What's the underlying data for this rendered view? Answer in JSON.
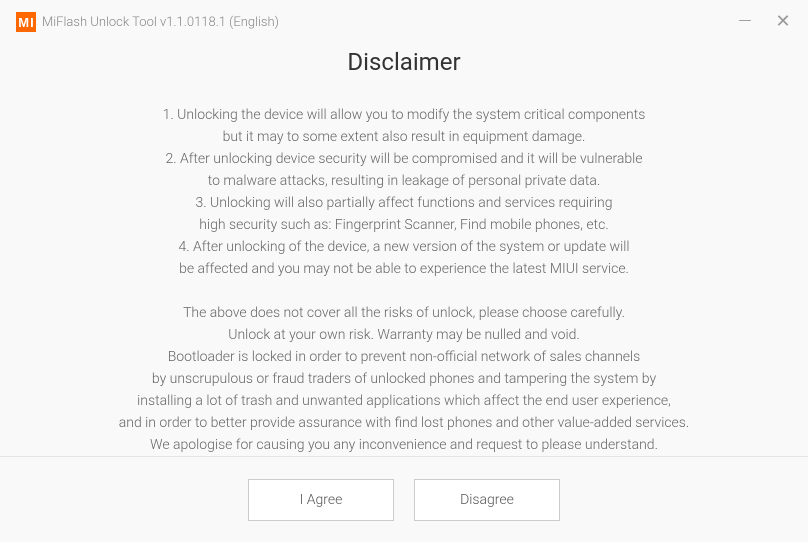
{
  "window": {
    "title": "MiFlash Unlock Tool v1.1.0118.1 (English)"
  },
  "heading": "Disclaimer",
  "lines": {
    "l1": "1. Unlocking the device will allow you to modify the system critical components",
    "l2": "but it may to some extent also result in equipment damage.",
    "l3": "2. After unlocking device security will be compromised and it will be vulnerable",
    "l4": "to malware attacks, resulting in leakage of personal private data.",
    "l5": "3. Unlocking will also partially affect functions and services requiring",
    "l6": "high security such as: Fingerprint Scanner, Find mobile phones, etc.",
    "l7": "4. After unlocking of the device, a new version of the system or update will",
    "l8": "be affected and you may not be able to experience the latest MIUI service.",
    "l9": "The above does not cover all the risks of unlock, please choose carefully.",
    "l10": "Unlock at your own risk. Warranty may be nulled and void.",
    "l11": "Bootloader is locked in order to prevent non-official network of sales channels",
    "l12": "by unscrupulous or fraud traders of unlocked phones and tampering the system by",
    "l13": "installing a lot of trash and unwanted applications which affect the end user experience,",
    "l14": "and in order to better provide assurance with find lost phones and other value-added services.",
    "l15": "We apologise for causing you any inconvenience and request to please understand."
  },
  "buttons": {
    "agree": "I Agree",
    "disagree": "Disagree"
  }
}
